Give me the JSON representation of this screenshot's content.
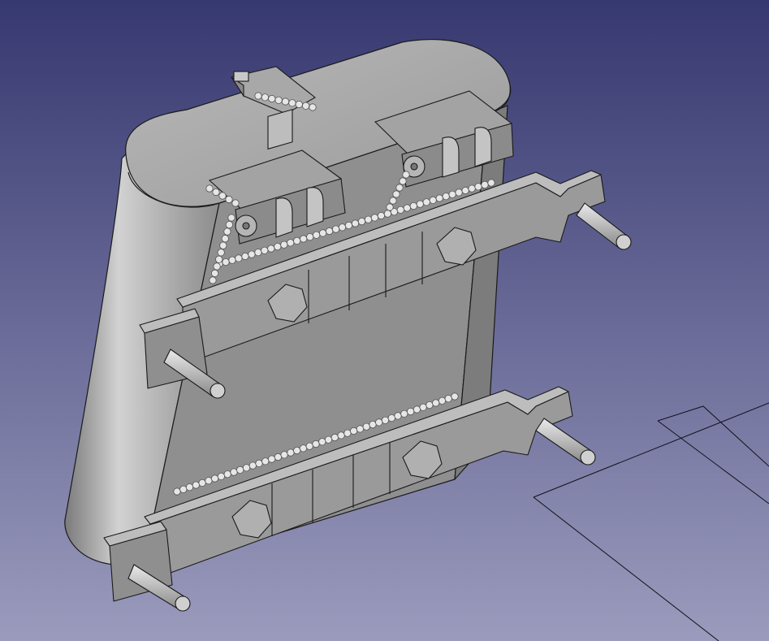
{
  "viewport": {
    "background_top": "#363870",
    "background_bottom": "#9b9bbd"
  },
  "model": {
    "body_light": "#c9c9c9",
    "body_mid": "#9e9e9e",
    "body_dark": "#6e6e6e",
    "face": "#8e8e8e",
    "edge": "#1a1a1a",
    "bead": "#e6e6e6",
    "bracket": "#9a9a9a",
    "bolt_count_per_bracket": 2,
    "stud_count_per_bracket": 2
  },
  "grid": {
    "line_color": "#101018"
  }
}
